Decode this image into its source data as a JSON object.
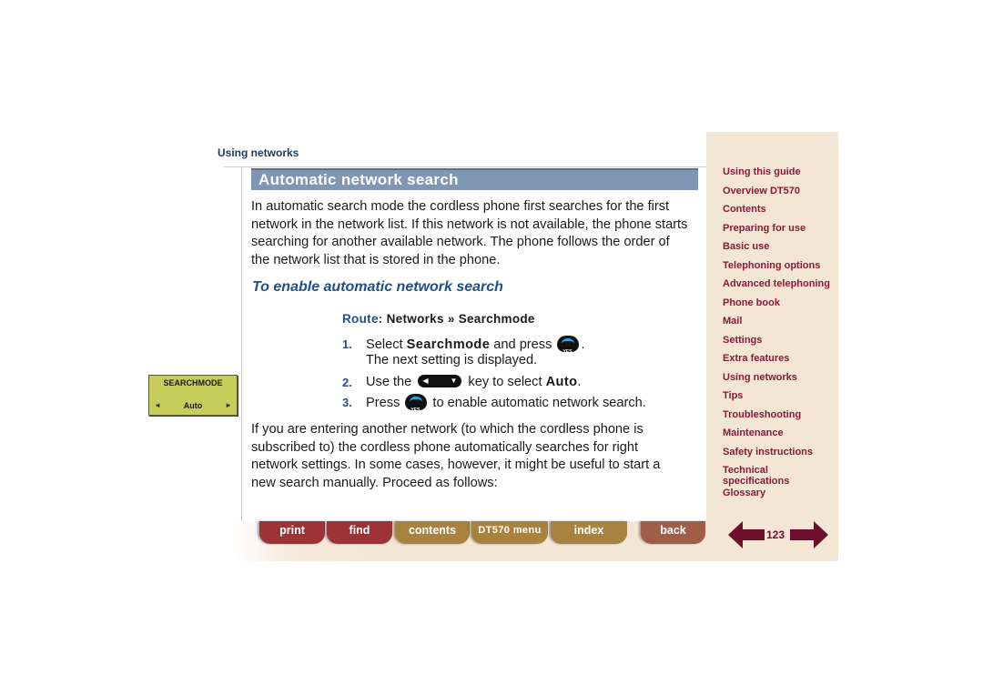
{
  "breadcrumb": "Using networks",
  "section_title": "Automatic network search",
  "intro_paragraph": "In automatic search mode the cordless phone first searches for the first network in the network list. If this network is not available, the phone starts searching for another available network. The phone follows the order of the network list that is stored in the phone.",
  "subheading": "To enable automatic network search",
  "route": {
    "label": "Route:",
    "path": "Networks » Searchmode"
  },
  "steps": [
    {
      "number": "1.",
      "before": "Select ",
      "keyword": "Searchmode",
      "after": " and press ",
      "key_icon": "yes-key-icon",
      "end": ".",
      "subtext": "The next setting is displayed."
    },
    {
      "number": "2.",
      "before": "Use the ",
      "key_icon": "nav-key-icon",
      "after": " key to select ",
      "keyword": "Auto",
      "end": "."
    },
    {
      "number": "3.",
      "before": "Press ",
      "key_icon": "yes-key-icon",
      "after": " to enable automatic network search."
    }
  ],
  "outro_paragraph": "If you are entering another network (to which the cordless phone is subscribed to) the cordless phone automatically searches for right network settings. In some cases, however, it might be useful to start a new search manually. Proceed as follows:",
  "lcd_display": {
    "title": "SEARCHMODE",
    "value": "Auto",
    "left_arrow": "◄",
    "right_arrow": "►"
  },
  "sidebar": {
    "items": [
      {
        "label": "Using this guide"
      },
      {
        "label": "Overview DT570"
      },
      {
        "label": "Contents"
      },
      {
        "label": "Preparing for use"
      },
      {
        "label": "Basic use"
      },
      {
        "label": "Telephoning options"
      },
      {
        "label": "Advanced telephoning"
      },
      {
        "label": "Phone book"
      },
      {
        "label": "Mail"
      },
      {
        "label": "Settings"
      },
      {
        "label": "Extra features"
      },
      {
        "label": "Using networks"
      },
      {
        "label": "Tips"
      },
      {
        "label": "Troubleshooting"
      },
      {
        "label": "Maintenance"
      },
      {
        "label": "Safety instructions"
      },
      {
        "label": "Technical specifications"
      },
      {
        "label": "Glossary"
      }
    ]
  },
  "bottom_nav": {
    "print": "print",
    "find": "find",
    "contents": "contents",
    "menu": "DT570 menu",
    "index": "index",
    "back": "back"
  },
  "pager": {
    "page_number": "123"
  },
  "colors": {
    "title_bar": "#7f97b4",
    "heading_blue": "#1f4f8c",
    "sidebar_bg": "#f3e6d4",
    "sidebar_link": "#8a1a38",
    "btn_red": "#9e3335",
    "btn_gold": "#a8823f",
    "btn_brown": "#a05d47",
    "lcd_bg": "#c6cd5a"
  }
}
